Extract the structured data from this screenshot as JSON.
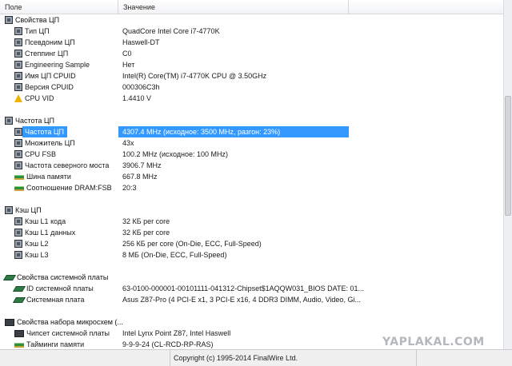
{
  "header": {
    "field": "Поле",
    "value": "Значение"
  },
  "groups": {
    "cpu": "Свойства ЦП",
    "freq": "Частота ЦП",
    "cache": "Кэш ЦП",
    "board": "Свойства системной платы",
    "chipset": "Свойства набора микросхем (..."
  },
  "cpu": {
    "type": {
      "label": "Тип ЦП",
      "value": "QuadCore Intel Core i7-4770K"
    },
    "alias": {
      "label": "Псевдоним ЦП",
      "value": "Haswell-DT"
    },
    "stepping": {
      "label": "Степпинг ЦП",
      "value": "C0"
    },
    "eng": {
      "label": "Engineering Sample",
      "value": "Нет"
    },
    "name": {
      "label": "Имя ЦП CPUID",
      "value": "Intel(R) Core(TM) i7-4770K CPU @ 3.50GHz"
    },
    "rev": {
      "label": "Версия CPUID",
      "value": "000306C3h"
    },
    "vid": {
      "label": "CPU VID",
      "value": "1.4410 V"
    }
  },
  "freq": {
    "clock": {
      "label": "Частота ЦП",
      "value": "4307.4 MHz  (исходное: 3500 MHz, разгон: 23%)"
    },
    "mult": {
      "label": "Множитель ЦП",
      "value": "43x"
    },
    "fsb": {
      "label": "CPU FSB",
      "value": "100.2 MHz  (исходное: 100 MHz)"
    },
    "nb": {
      "label": "Частота северного моста",
      "value": "3906.7 MHz"
    },
    "membus": {
      "label": "Шина памяти",
      "value": "667.8 MHz"
    },
    "ratio": {
      "label": "Соотношение DRAM:FSB",
      "value": "20:3"
    }
  },
  "cache": {
    "l1c": {
      "label": "Кэш L1 кода",
      "value": "32 КБ per core"
    },
    "l1d": {
      "label": "Кэш L1 данных",
      "value": "32 КБ per core"
    },
    "l2": {
      "label": "Кэш L2",
      "value": "256 КБ per core  (On-Die, ECC, Full-Speed)"
    },
    "l3": {
      "label": "Кэш L3",
      "value": "8 МБ  (On-Die, ECC, Full-Speed)"
    }
  },
  "board": {
    "id": {
      "label": "ID системной платы",
      "value": "63-0100-000001-00101111-041312-Chipset$1AQQW031_BIOS DATE: 01..."
    },
    "model": {
      "label": "Системная плата",
      "value": "Asus Z87-Pro  (4 PCI-E x1, 3 PCI-E x16, 4 DDR3 DIMM, Audio, Video, Gi..."
    }
  },
  "chipset": {
    "chip": {
      "label": "Чипсет системной платы",
      "value": "Intel Lynx Point Z87, Intel Haswell"
    },
    "timings": {
      "label": "Тайминги памяти",
      "value": "9-9-9-24  (CL-RCD-RP-RAS)"
    }
  },
  "status": {
    "copyright": "Copyright (c) 1995-2014 FinalWire Ltd."
  },
  "watermark": "YAPLAKAL.COM"
}
